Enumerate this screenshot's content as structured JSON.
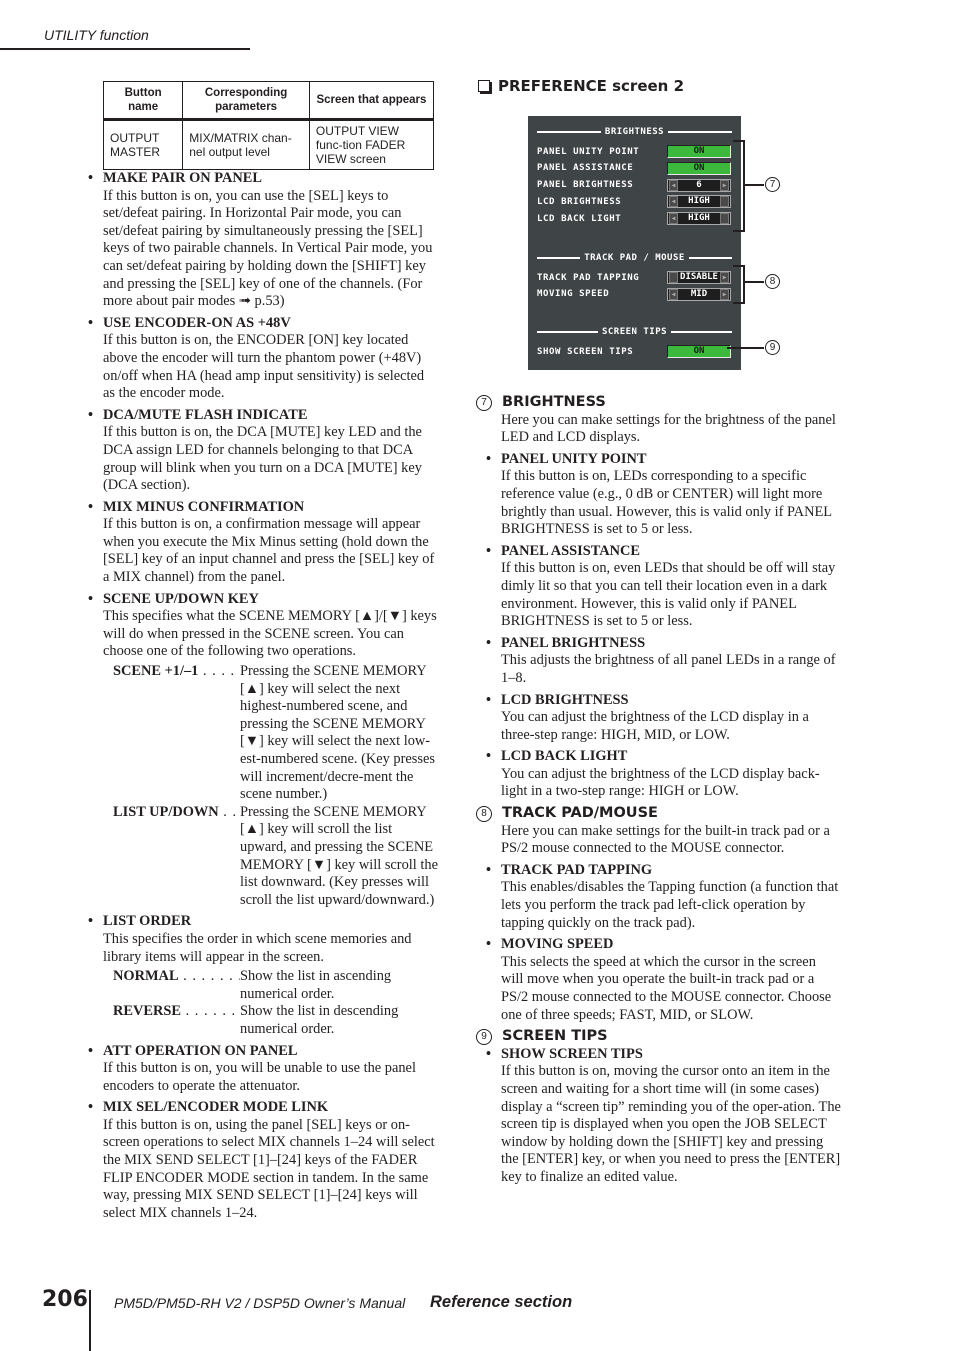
{
  "header": {
    "running_head": "UTILITY function"
  },
  "table": {
    "headers": [
      "Button name",
      "Corresponding parameters",
      "Screen that appears"
    ],
    "rows": [
      [
        "OUTPUT MASTER",
        "MIX/MATRIX chan-nel output level",
        "OUTPUT VIEW func-tion FADER VIEW screen"
      ]
    ]
  },
  "left_items": [
    {
      "title": "MAKE PAIR ON PANEL",
      "body": "If this button is on, you can use the [SEL] keys to set/defeat pairing. In Horizontal Pair mode, you can set/defeat pairing by simultaneously pressing the [SEL] keys of two pairable channels. In Vertical Pair mode, you can set/defeat pairing by holding down the [SHIFT] key and pressing the [SEL] key of one of the channels. (For more about pair modes ➟ p.53)"
    },
    {
      "title": "USE ENCODER-ON AS +48V",
      "body": "If this button is on, the ENCODER [ON] key located above the encoder will turn the phantom power (+48V) on/off when HA (head amp input sensitivity) is selected as the encoder mode."
    },
    {
      "title": "DCA/MUTE FLASH INDICATE",
      "body": "If this button is on, the DCA [MUTE] key LED and the DCA assign LED for channels belonging to that DCA group will blink when you turn on a DCA [MUTE] key (DCA section)."
    },
    {
      "title": "MIX MINUS CONFIRMATION",
      "body": "If this button is on, a confirmation message will appear when you execute the Mix Minus setting (hold down the [SEL] key of an input channel and press the [SEL] key of a MIX channel) from the panel."
    },
    {
      "title": "SCENE UP/DOWN KEY",
      "body": "This specifies what the SCENE MEMORY [▲]/[▼] keys will do when pressed in the SCENE screen. You can choose one of the following two operations.",
      "options": [
        {
          "term": "SCENE +1/–1",
          "leader": " . . . . .",
          "desc": "Pressing the SCENE MEMORY [▲] key will select the next highest-numbered scene, and pressing the SCENE MEMORY [▼] key will select the next low-est-numbered scene. (Key presses will increment/decre-ment the scene number.)"
        },
        {
          "term": "LIST UP/DOWN",
          "leader": " . .",
          "desc": "Pressing the SCENE MEMORY [▲] key will scroll the list upward, and pressing the SCENE MEMORY [▼] key will scroll the list downward. (Key presses will scroll the list upward/downward.)"
        }
      ]
    },
    {
      "title": "LIST ORDER",
      "body": "This specifies the order in which scene memories and library items will appear in the screen.",
      "options": [
        {
          "term": "NORMAL",
          "leader": " . . . . . . . .",
          "desc": "Show the list in ascending numerical order."
        },
        {
          "term": "REVERSE",
          "leader": " . . . . . . . .",
          "desc": "Show the list in descending numerical order."
        }
      ]
    },
    {
      "title": "ATT OPERATION ON PANEL",
      "body": "If this button is on, you will be unable to use the panel encoders to operate the attenuator."
    },
    {
      "title": "MIX SEL/ENCODER MODE LINK",
      "body": "If this button is on, using the panel [SEL] keys or on-screen operations to select MIX channels 1–24 will select the MIX SEND SELECT [1]–[24] keys of the FADER FLIP ENCODER MODE section in tandem. In the same way, pressing MIX SEND SELECT [1]–[24] keys will select MIX channels 1–24."
    }
  ],
  "pref_screen": {
    "heading": "PREFERENCE screen 2",
    "groups": [
      {
        "title": "BRIGHTNESS",
        "callout": "7",
        "rows": [
          {
            "label": "PANEL UNITY POINT",
            "type": "toggle",
            "value": "ON"
          },
          {
            "label": "PANEL ASSISTANCE",
            "type": "toggle",
            "value": "ON"
          },
          {
            "label": "PANEL BRIGHTNESS",
            "type": "select",
            "value": "6"
          },
          {
            "label": "LCD BRIGHTNESS",
            "type": "select",
            "value": "HIGH"
          },
          {
            "label": "LCD BACK LIGHT",
            "type": "select",
            "value": "HIGH"
          }
        ]
      },
      {
        "title": "TRACK PAD / MOUSE",
        "callout": "8",
        "rows": [
          {
            "label": "TRACK PAD TAPPING",
            "type": "select",
            "value": "DISABLE"
          },
          {
            "label": "MOVING SPEED",
            "type": "select",
            "value": "MID"
          }
        ]
      },
      {
        "title": "SCREEN TIPS",
        "callout": "9",
        "rows": [
          {
            "label": "SHOW SCREEN TIPS",
            "type": "toggle",
            "value": "ON"
          }
        ]
      }
    ],
    "toggle_color": "#3cb83c",
    "screen_bg": "#3f4446"
  },
  "right_sections": [
    {
      "num": "7",
      "title": "BRIGHTNESS",
      "desc": "Here you can make settings for the brightness of the panel LED and LCD displays.",
      "items": [
        {
          "title": "PANEL UNITY POINT",
          "body": "If this button is on, LEDs corresponding to a specific reference value (e.g., 0 dB or CENTER) will light more brightly than usual. However, this is valid only if PANEL BRIGHTNESS is set to 5 or less."
        },
        {
          "title": "PANEL ASSISTANCE",
          "body": "If this button is on, even LEDs that should be off will stay dimly lit so that you can tell their location even in a dark environment. However, this is valid only if PANEL BRIGHTNESS is set to 5 or less."
        },
        {
          "title": "PANEL BRIGHTNESS",
          "body": "This adjusts the brightness of all panel LEDs in a range of 1–8."
        },
        {
          "title": "LCD BRIGHTNESS",
          "body": "You can adjust the brightness of the LCD display in a three-step range: HIGH, MID, or LOW."
        },
        {
          "title": "LCD BACK LIGHT",
          "body": "You can adjust the brightness of the LCD display back-light in a two-step range: HIGH or LOW."
        }
      ]
    },
    {
      "num": "8",
      "title": "TRACK PAD/MOUSE",
      "desc": "Here you can make settings for the built-in track pad or a PS/2 mouse connected to the MOUSE connector.",
      "items": [
        {
          "title": "TRACK PAD TAPPING",
          "body": "This enables/disables the Tapping function (a function that lets you perform the track pad left-click operation by tapping quickly on the track pad)."
        },
        {
          "title": "MOVING SPEED",
          "body": "This selects the speed at which the cursor in the screen will move when you operate the built-in track pad or a PS/2 mouse connected to the MOUSE connector. Choose one of three speeds; FAST, MID, or SLOW."
        }
      ]
    },
    {
      "num": "9",
      "title": "SCREEN TIPS",
      "desc": "",
      "items": [
        {
          "title": "SHOW SCREEN TIPS",
          "body": "If this button is on, moving the cursor onto an item in the screen and waiting for a short time will (in some cases) display a “screen tip” reminding you of the oper-ation. The screen tip is displayed when you open the JOB SELECT window by holding down the [SHIFT] key and pressing the [ENTER] key, or when you need to press the [ENTER] key to finalize an edited value."
        }
      ]
    }
  ],
  "footer": {
    "page_number": "206",
    "manual_title": "PM5D/PM5D-RH V2 / DSP5D Owner’s Manual",
    "section": "Reference section"
  }
}
